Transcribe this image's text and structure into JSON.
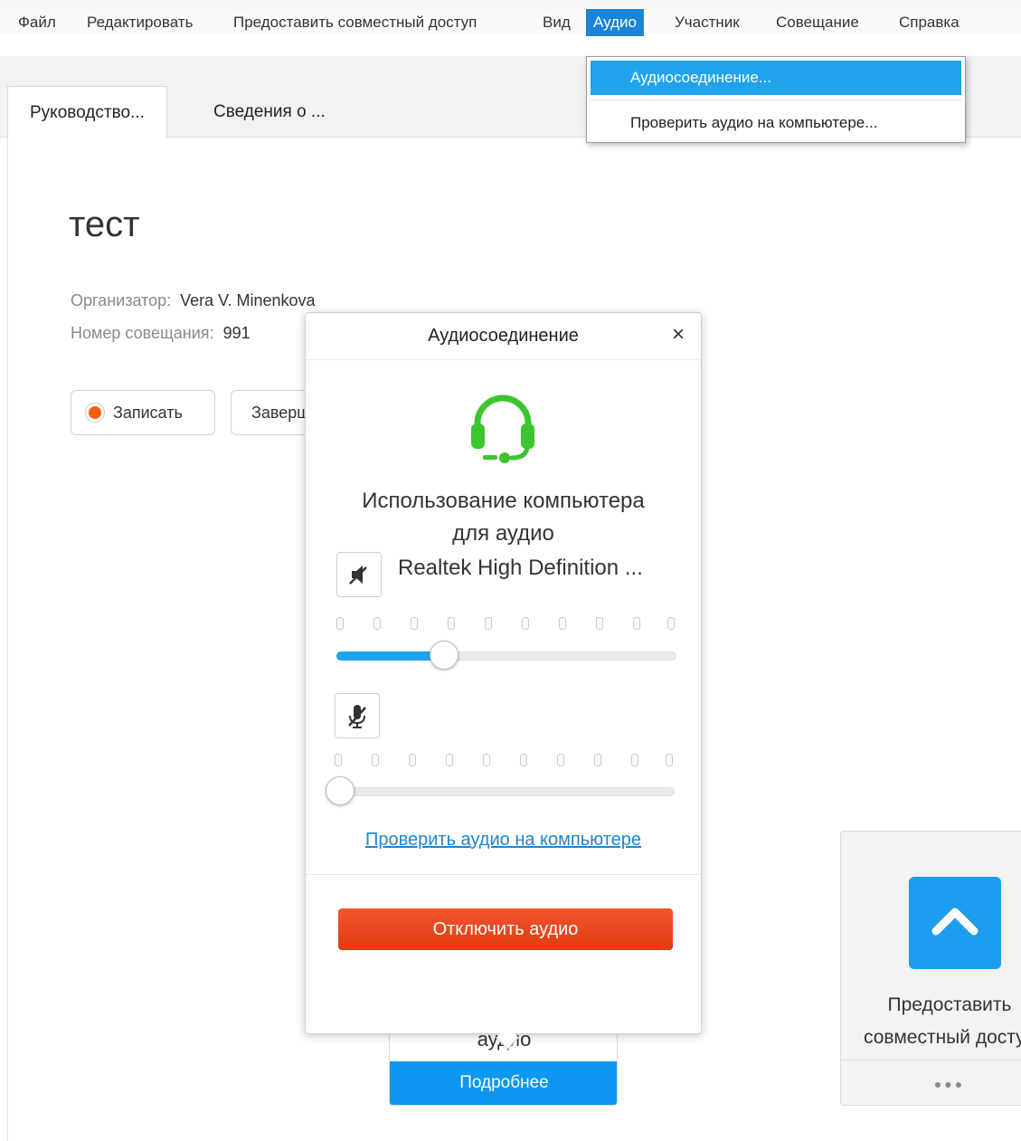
{
  "menubar": {
    "items": [
      "Файл",
      "Редактировать",
      "Предоставить совместный доступ",
      "Вид",
      "Аудио",
      "Участник",
      "Совещание",
      "Справка"
    ]
  },
  "tabs": [
    "Руководство...",
    "Сведения о ..."
  ],
  "meeting": {
    "title": "тест",
    "organizer_label": "Организатор:",
    "organizer_value": "Vera V. Minenkova",
    "number_label": "Номер совещания:",
    "number_value": "991",
    "record_button": "Записать",
    "end_button": "Завершить"
  },
  "audio_menu": {
    "items": [
      "Аудиосоединение...",
      "Проверить аудио на компьютере..."
    ]
  },
  "popup": {
    "title": "Аудиосоединение",
    "close": "×",
    "use_computer_line1": "Использование компьютера",
    "use_computer_line2": "для аудио",
    "speaker_device": "Realtek High Definition ...",
    "speaker_volume": 0.3,
    "mic_volume": 0.0,
    "test_link": "Проверить аудио на компьютере",
    "disconnect_button": "Отключить аудио"
  },
  "cards": {
    "share_line1": "Предоставить",
    "share_line2": "совместный доступ",
    "more_dots": "●●●",
    "audio_label": "аудио",
    "details_button": "Подробнее"
  },
  "colors": {
    "accent_blue": "#1ea4ef",
    "menu_highlight": "#1fa3ee",
    "headset_green": "#3cc52f",
    "disconnect_red": "#e9441a",
    "record_orange": "#fe5b0c"
  }
}
